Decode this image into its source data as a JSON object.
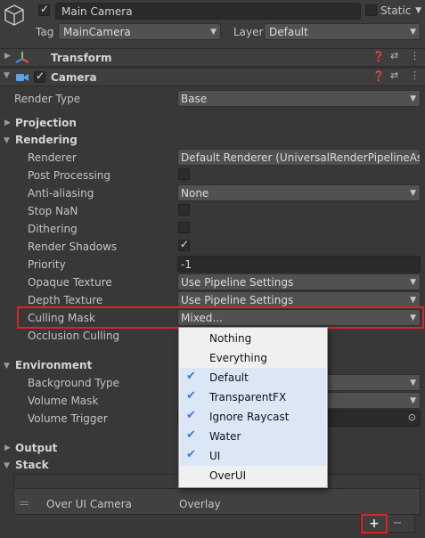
{
  "header": {
    "object_name": "Main Camera",
    "static_label": "Static",
    "tag_label": "Tag",
    "tag_value": "MainCamera",
    "layer_label": "Layer",
    "layer_value": "Default"
  },
  "components": {
    "transform": {
      "title": "Transform"
    },
    "camera": {
      "title": "Camera"
    }
  },
  "camera": {
    "render_type": {
      "label": "Render Type",
      "value": "Base"
    },
    "projection": "Projection",
    "rendering": "Rendering",
    "renderer": {
      "label": "Renderer",
      "value": "Default Renderer (UniversalRenderPipelineAs"
    },
    "post_processing": {
      "label": "Post Processing",
      "checked": false
    },
    "anti_aliasing": {
      "label": "Anti-aliasing",
      "value": "None"
    },
    "stop_nan": {
      "label": "Stop NaN",
      "checked": false
    },
    "dithering": {
      "label": "Dithering",
      "checked": false
    },
    "render_shadows": {
      "label": "Render Shadows",
      "checked": true
    },
    "priority": {
      "label": "Priority",
      "value": "-1"
    },
    "opaque_texture": {
      "label": "Opaque Texture",
      "value": "Use Pipeline Settings"
    },
    "depth_texture": {
      "label": "Depth Texture",
      "value": "Use Pipeline Settings"
    },
    "culling_mask": {
      "label": "Culling Mask",
      "value": "Mixed..."
    },
    "occlusion_culling": {
      "label": "Occlusion Culling"
    },
    "environment": "Environment",
    "background_type": {
      "label": "Background Type"
    },
    "volume_mask": {
      "label": "Volume Mask"
    },
    "volume_trigger": {
      "label": "Volume Trigger"
    },
    "output": "Output",
    "stack": "Stack",
    "stack_entry": {
      "name": "Over UI Camera",
      "type": "Overlay"
    },
    "add_label": "+",
    "remove_label": "−"
  },
  "culling_menu": [
    {
      "label": "Nothing",
      "checked": false
    },
    {
      "label": "Everything",
      "checked": false
    },
    {
      "label": "Default",
      "checked": true
    },
    {
      "label": "TransparentFX",
      "checked": true
    },
    {
      "label": "Ignore Raycast",
      "checked": true
    },
    {
      "label": "Water",
      "checked": true
    },
    {
      "label": "UI",
      "checked": true
    },
    {
      "label": "OverUI",
      "checked": false
    }
  ],
  "colors": {
    "background": "#383838",
    "highlight": "#e21f26",
    "menu_check": "#3b7bd4",
    "menu_selected": "#dce7f6"
  }
}
